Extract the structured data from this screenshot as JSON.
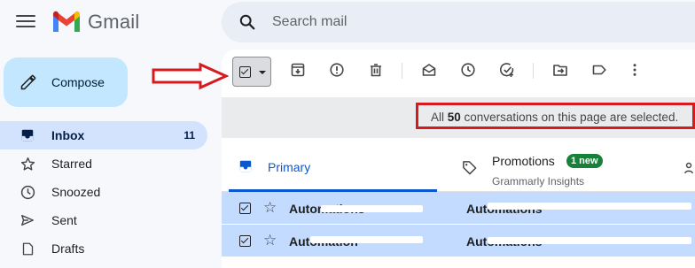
{
  "app": {
    "name": "Gmail"
  },
  "search": {
    "placeholder": "Search mail"
  },
  "compose": {
    "label": "Compose"
  },
  "nav": {
    "items": [
      {
        "label": "Inbox",
        "count": "11",
        "icon": "inbox-icon",
        "active": true
      },
      {
        "label": "Starred",
        "count": "",
        "icon": "star-icon"
      },
      {
        "label": "Snoozed",
        "count": "",
        "icon": "clock-icon"
      },
      {
        "label": "Sent",
        "count": "",
        "icon": "send-icon"
      },
      {
        "label": "Drafts",
        "count": "",
        "icon": "draft-icon"
      }
    ]
  },
  "toolbar": {
    "icons": [
      "select-all-checkbox",
      "archive-icon",
      "report-spam-icon",
      "delete-icon",
      "mark-read-icon",
      "snooze-icon",
      "add-task-icon",
      "move-to-icon",
      "label-icon",
      "more-icon"
    ]
  },
  "banner": {
    "prefix": "All ",
    "count": "50",
    "suffix": " conversations on this page are selected."
  },
  "tabs": {
    "primary": {
      "label": "Primary"
    },
    "promotions": {
      "label": "Promotions",
      "badge": "1 new",
      "subtitle": "Grammarly Insights"
    }
  },
  "emails": [
    {
      "sender": "Automations",
      "subject": "Automations",
      "selected": true
    },
    {
      "sender": "Automation",
      "subject": "Automations",
      "selected": true
    }
  ],
  "colors": {
    "accent": "#0b57d0",
    "compose_bg": "#c2e7ff",
    "selected_row": "#c2dbff",
    "annotation_red": "#d71920",
    "badge_green": "#188038"
  }
}
